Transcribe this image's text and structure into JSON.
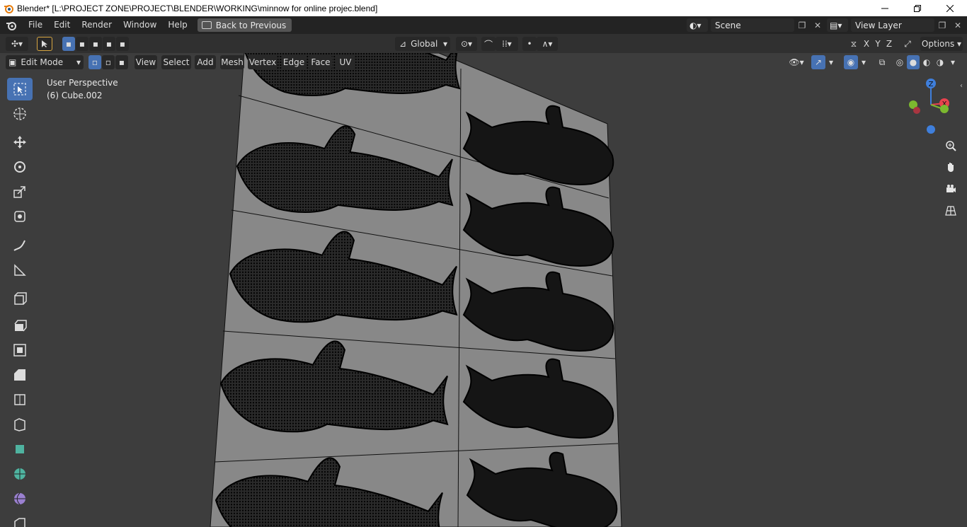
{
  "window": {
    "title": "Blender* [L:\\PROJECT ZONE\\PROJECT\\BLENDER\\WORKING\\minnow for online projec.blend]"
  },
  "menu": {
    "items": [
      "File",
      "Edit",
      "Render",
      "Window",
      "Help"
    ],
    "back_button": "Back to Previous"
  },
  "scene": {
    "name": "Scene",
    "view_layer": "View Layer"
  },
  "tool_header": {
    "orientation": "Global",
    "options": "Options"
  },
  "view_header": {
    "mode": "Edit Mode",
    "menus": [
      "View",
      "Select",
      "Add",
      "Mesh",
      "Vertex",
      "Edge",
      "Face",
      "UV"
    ],
    "axes": [
      "X",
      "Y",
      "Z"
    ]
  },
  "viewport": {
    "perspective": "User Perspective",
    "object": "(6) Cube.002"
  },
  "gizmo": {
    "x": "X",
    "y": "Y",
    "z": "Z"
  },
  "colors": {
    "accent": "#4772b3",
    "axis_x": "#e8424e",
    "axis_y": "#7cb82f",
    "axis_z": "#3f7fdc"
  }
}
